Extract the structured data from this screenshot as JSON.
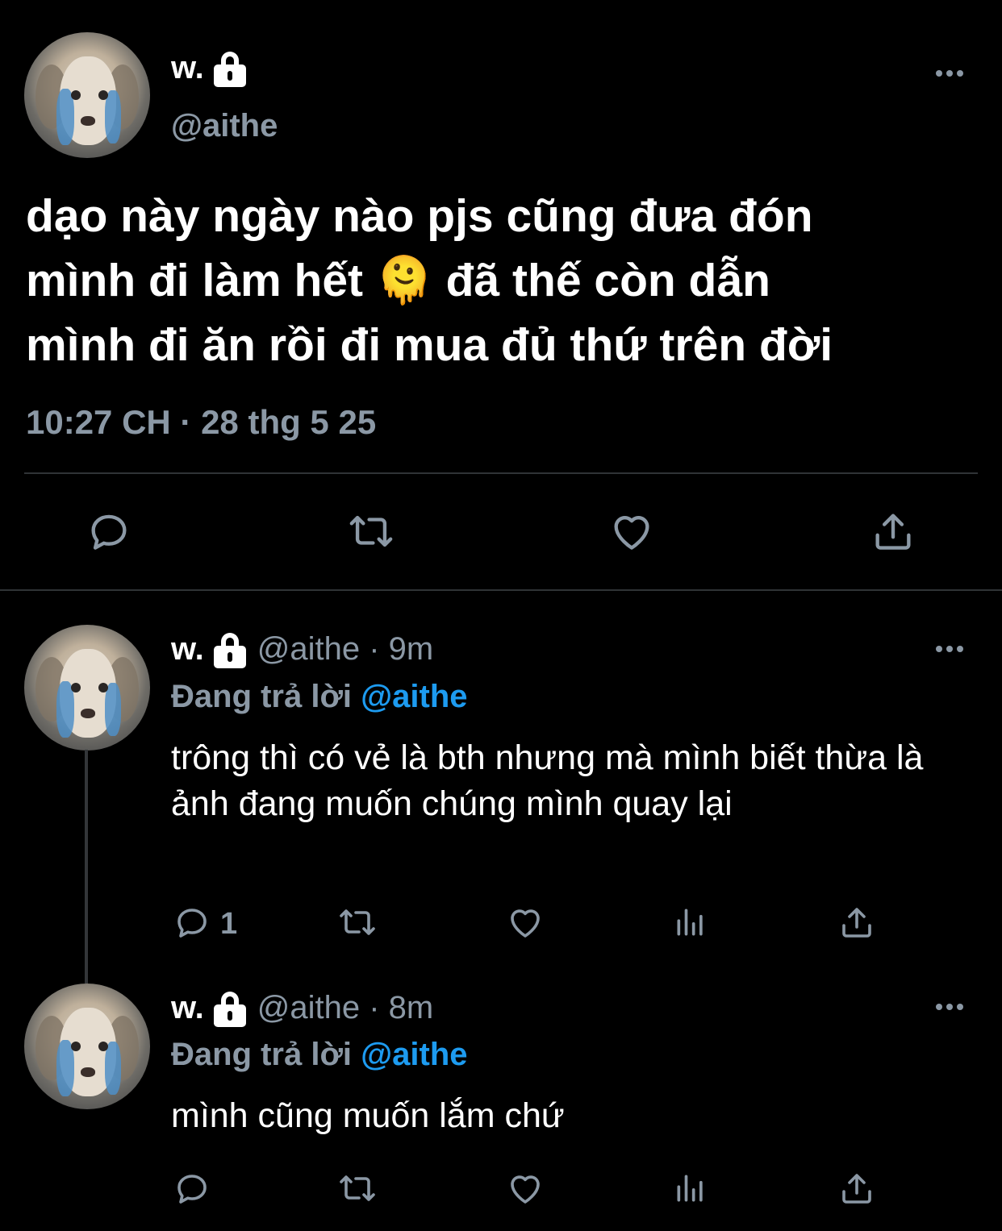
{
  "main_tweet": {
    "display_name": "w.",
    "handle": "@aithe",
    "text": "dạo này ngày nào pjs cũng đưa đón\nmình đi làm hết 🫠 đã thế còn dẫn\nmình đi ăn rồi đi mua đủ thứ trên đời",
    "timestamp": "10:27 CH · 28 thg 5 25",
    "icons": [
      "lock-icon",
      "more-icon",
      "reply-icon",
      "retweet-icon",
      "like-icon",
      "share-icon"
    ]
  },
  "replies": [
    {
      "display_name": "w.",
      "handle_time": "@aithe · 9m",
      "replying_prefix": "Đang trả lời",
      "replying_to": "@aithe",
      "text": "trông thì có vẻ là bth nhưng mà mình biết thừa là ảnh đang muốn chúng mình quay lại",
      "reply_count": "1"
    },
    {
      "display_name": "w.",
      "handle_time": "@aithe · 8m",
      "replying_prefix": "Đang trả lời",
      "replying_to": "@aithe",
      "text": "mình cũng muốn lắm chứ",
      "reply_count": ""
    }
  ],
  "colors": {
    "background": "#000000",
    "text": "#ffffff",
    "muted": "#8b98a5",
    "accent": "#1d9bf0",
    "divider": "#2f3336"
  }
}
